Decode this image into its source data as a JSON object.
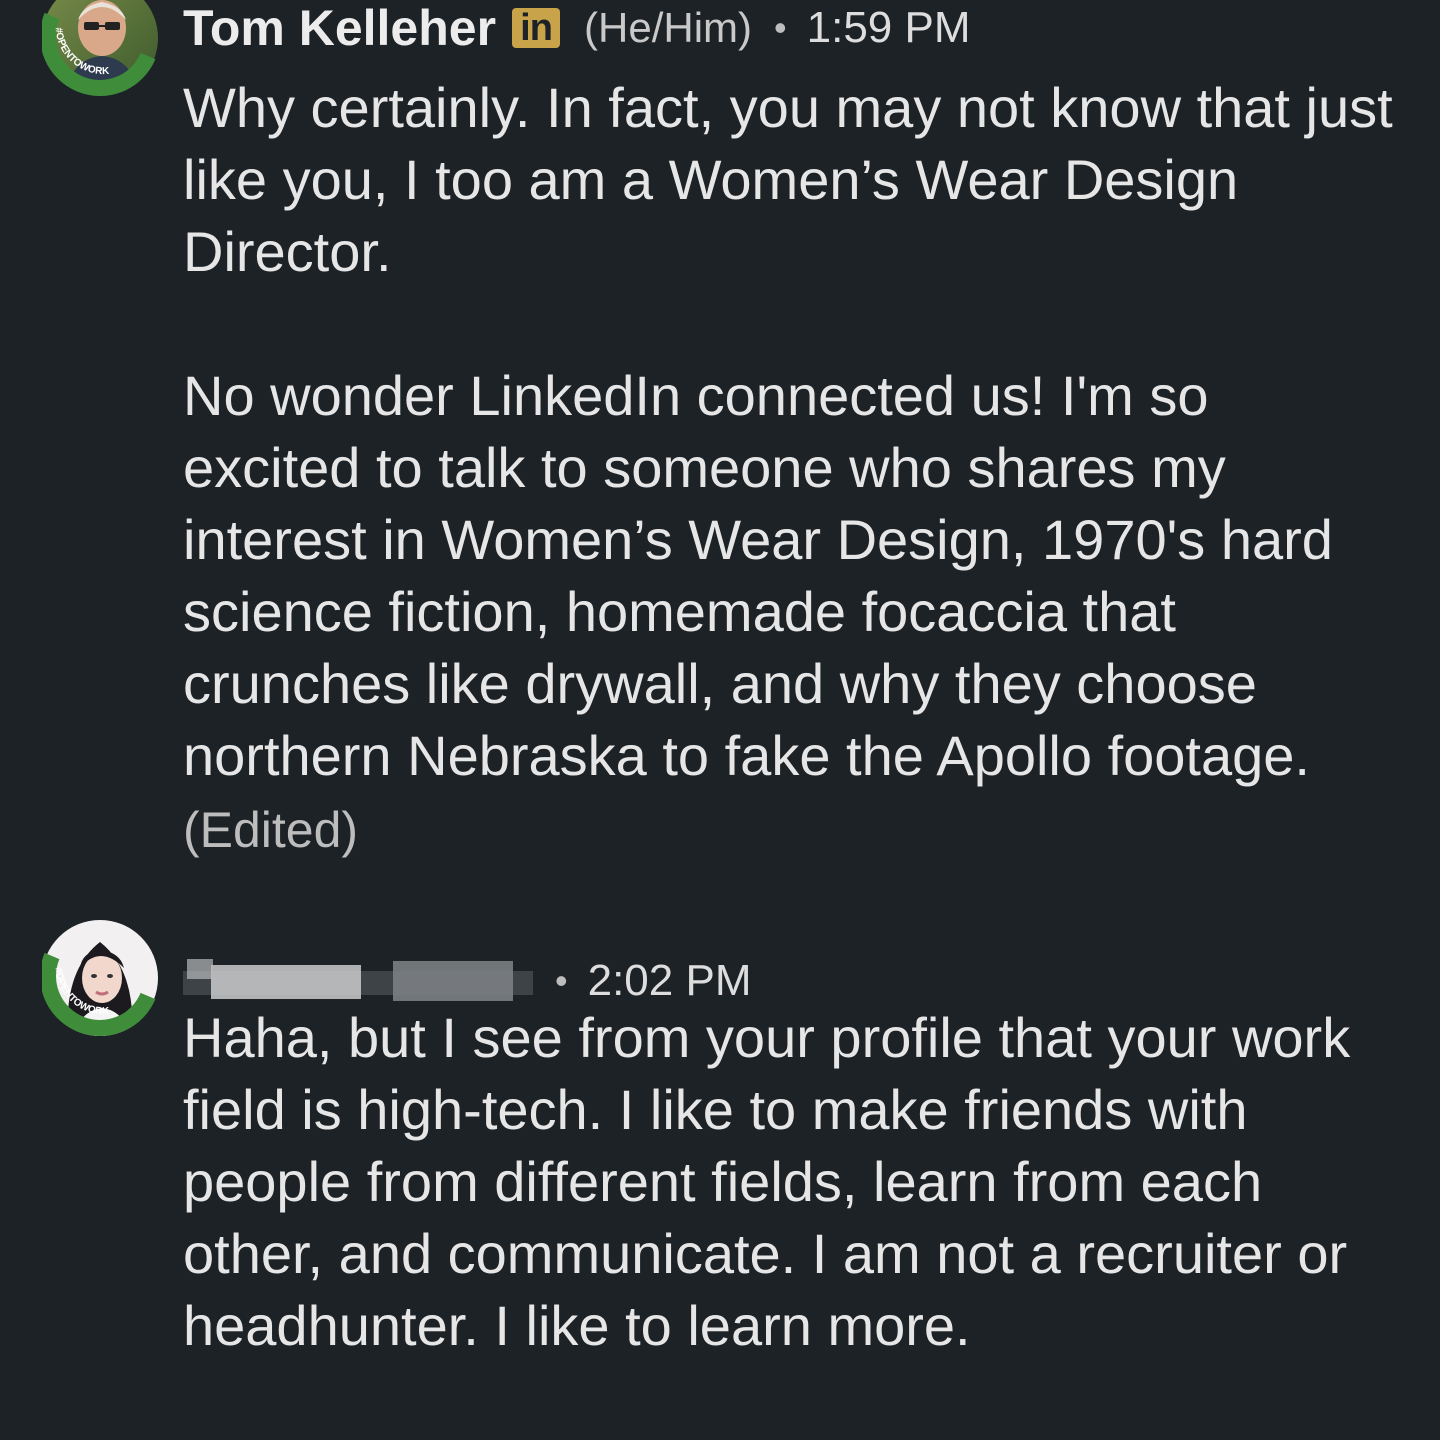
{
  "messages": [
    {
      "sender": "Tom Kelleher",
      "linkedin_badge": "in",
      "pronouns": "(He/Him)",
      "separator": "•",
      "time": "1:59 PM",
      "avatar_label": "#OPENTOWORK",
      "paragraphs": [
        "Why certainly.  In fact, you may not know that just like you, I too am a Women’s Wear Design Director.",
        "No wonder LinkedIn connected us!  I'm so excited to talk to someone who shares my interest in Women’s Wear Design, 1970's hard science fiction, homemade focaccia that crunches like drywall, and why they choose northern Nebraska to fake the Apollo footage."
      ],
      "edited_label": "(Edited)"
    },
    {
      "separator": "•",
      "time": "2:02 PM",
      "avatar_label": "#OPENTOWORK",
      "paragraphs": [
        "Haha, but I see from your profile that your work field is high-tech. I like to make friends with people from different fields, learn from each other, and communicate. I am not a recruiter or headhunter. I like to learn more."
      ]
    }
  ],
  "colors": {
    "background": "#1d2226",
    "text": "#e6e6e6",
    "open_to_work_green": "#3f8d3a",
    "linkedin_badge": "#c9a34a"
  }
}
